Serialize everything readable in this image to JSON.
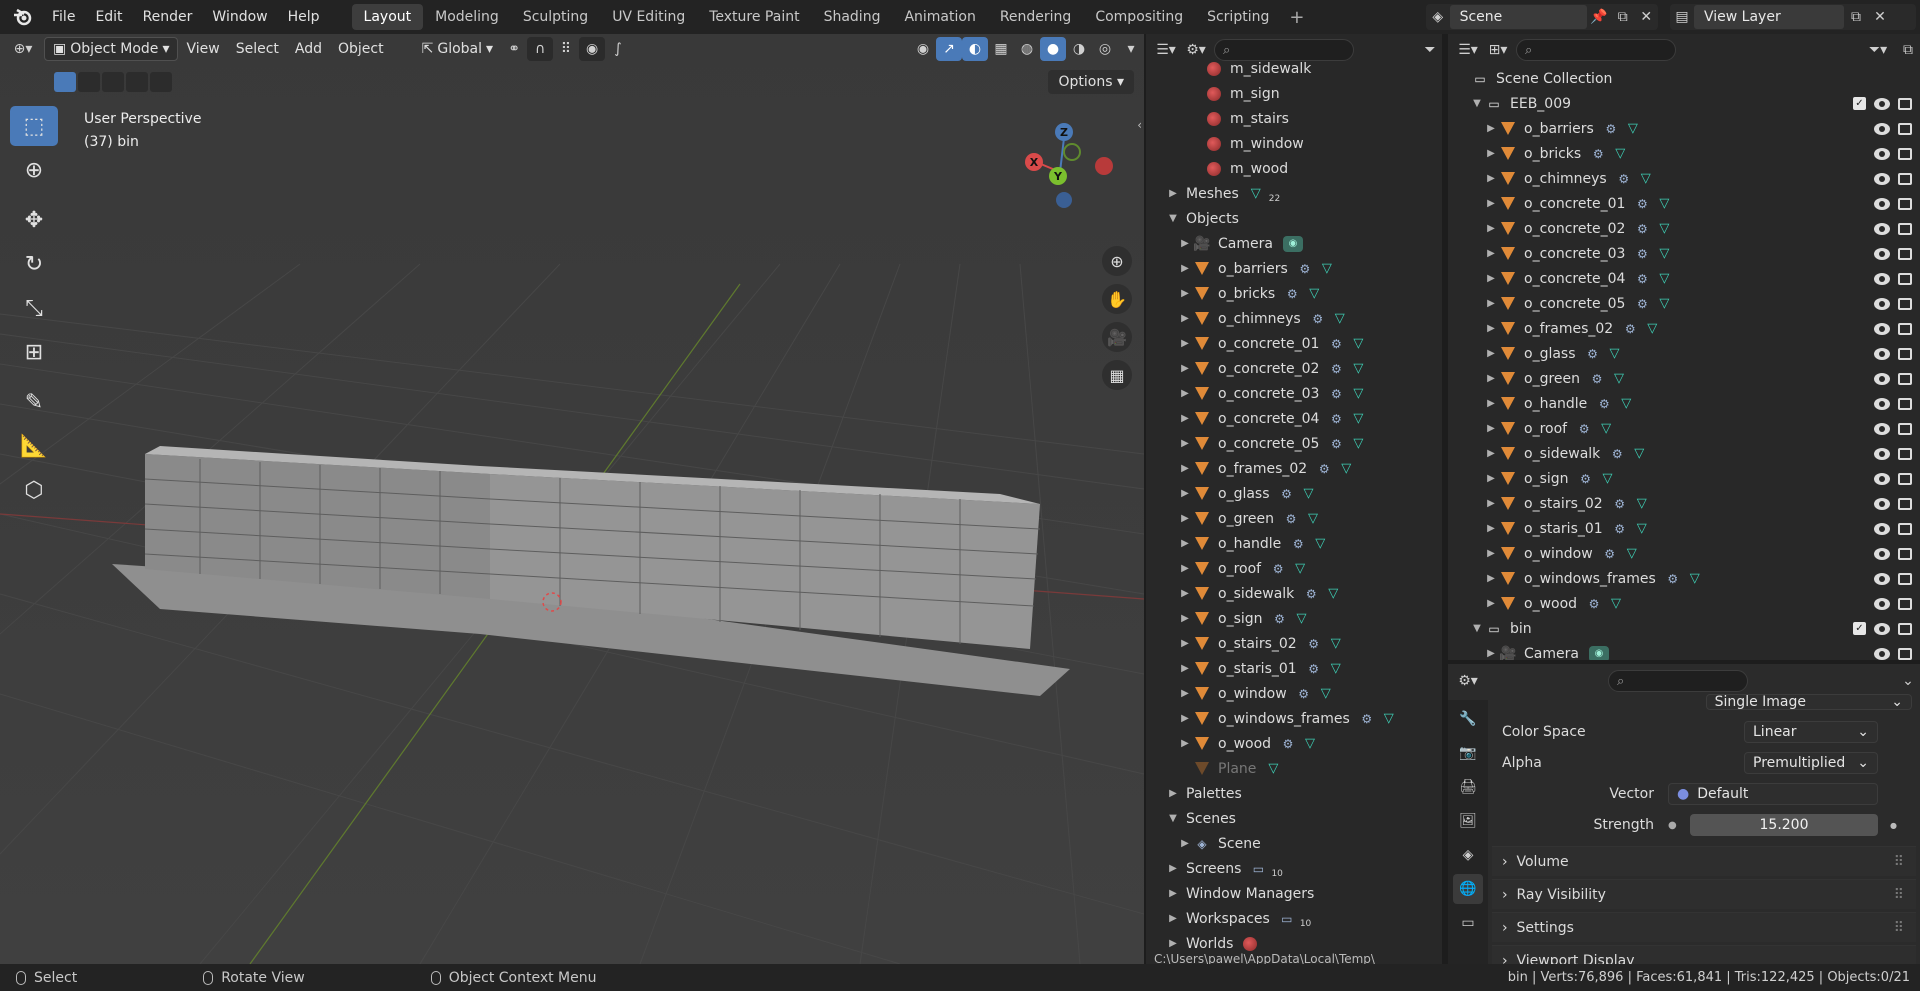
{
  "menu": {
    "items": [
      "File",
      "Edit",
      "Render",
      "Window",
      "Help"
    ]
  },
  "workspaces": {
    "tabs": [
      "Layout",
      "Modeling",
      "Sculpting",
      "UV Editing",
      "Texture Paint",
      "Shading",
      "Animation",
      "Rendering",
      "Compositing",
      "Scripting"
    ],
    "active": "Layout"
  },
  "scene": {
    "name": "Scene",
    "view_layer": "View Layer"
  },
  "viewport": {
    "mode": "Object Mode",
    "menus": [
      "View",
      "Select",
      "Add",
      "Object"
    ],
    "orientation": "Global",
    "info_line1": "User Perspective",
    "info_line2": "(37) bin",
    "options_label": "Options",
    "axes": {
      "x": "X",
      "y": "Y",
      "z": "Z"
    }
  },
  "outliner_file": {
    "rows": [
      {
        "indent": 3,
        "arrow": "",
        "icon": "material",
        "label": "m_sidewalk"
      },
      {
        "indent": 3,
        "arrow": "",
        "icon": "material",
        "label": "m_sign"
      },
      {
        "indent": 3,
        "arrow": "",
        "icon": "material",
        "label": "m_stairs"
      },
      {
        "indent": 3,
        "arrow": "",
        "icon": "material",
        "label": "m_window"
      },
      {
        "indent": 3,
        "arrow": "",
        "icon": "material",
        "label": "m_wood"
      },
      {
        "indent": 1,
        "arrow": "▶",
        "icon": "",
        "label": "Meshes",
        "badge": "mesh",
        "count": "22"
      },
      {
        "indent": 1,
        "arrow": "▼",
        "icon": "",
        "label": "Objects"
      },
      {
        "indent": 2,
        "arrow": "▶",
        "icon": "camera",
        "label": "Camera",
        "badge": "camdata"
      },
      {
        "indent": 2,
        "arrow": "▶",
        "icon": "object",
        "label": "o_barriers",
        "badge": "modmesh"
      },
      {
        "indent": 2,
        "arrow": "▶",
        "icon": "object",
        "label": "o_bricks",
        "badge": "modmesh"
      },
      {
        "indent": 2,
        "arrow": "▶",
        "icon": "object",
        "label": "o_chimneys",
        "badge": "modmesh"
      },
      {
        "indent": 2,
        "arrow": "▶",
        "icon": "object",
        "label": "o_concrete_01",
        "badge": "modmesh"
      },
      {
        "indent": 2,
        "arrow": "▶",
        "icon": "object",
        "label": "o_concrete_02",
        "badge": "modmesh"
      },
      {
        "indent": 2,
        "arrow": "▶",
        "icon": "object",
        "label": "o_concrete_03",
        "badge": "modmesh"
      },
      {
        "indent": 2,
        "arrow": "▶",
        "icon": "object",
        "label": "o_concrete_04",
        "badge": "modmesh"
      },
      {
        "indent": 2,
        "arrow": "▶",
        "icon": "object",
        "label": "o_concrete_05",
        "badge": "modmesh"
      },
      {
        "indent": 2,
        "arrow": "▶",
        "icon": "object",
        "label": "o_frames_02",
        "badge": "modmesh"
      },
      {
        "indent": 2,
        "arrow": "▶",
        "icon": "object",
        "label": "o_glass",
        "badge": "modmesh"
      },
      {
        "indent": 2,
        "arrow": "▶",
        "icon": "object",
        "label": "o_green",
        "badge": "modmesh"
      },
      {
        "indent": 2,
        "arrow": "▶",
        "icon": "object",
        "label": "o_handle",
        "badge": "modmesh"
      },
      {
        "indent": 2,
        "arrow": "▶",
        "icon": "object",
        "label": "o_roof",
        "badge": "modmesh"
      },
      {
        "indent": 2,
        "arrow": "▶",
        "icon": "object",
        "label": "o_sidewalk",
        "badge": "modmesh"
      },
      {
        "indent": 2,
        "arrow": "▶",
        "icon": "object",
        "label": "o_sign",
        "badge": "modmesh"
      },
      {
        "indent": 2,
        "arrow": "▶",
        "icon": "object",
        "label": "o_stairs_02",
        "badge": "modmesh"
      },
      {
        "indent": 2,
        "arrow": "▶",
        "icon": "object",
        "label": "o_staris_01",
        "badge": "modmesh"
      },
      {
        "indent": 2,
        "arrow": "▶",
        "icon": "object",
        "label": "o_window",
        "badge": "modmesh"
      },
      {
        "indent": 2,
        "arrow": "▶",
        "icon": "object",
        "label": "o_windows_frames",
        "badge": "modmesh"
      },
      {
        "indent": 2,
        "arrow": "▶",
        "icon": "object",
        "label": "o_wood",
        "badge": "modmesh"
      },
      {
        "indent": 2,
        "arrow": "",
        "icon": "object-dim",
        "label": "Plane",
        "badge": "mesh",
        "dim": true
      },
      {
        "indent": 1,
        "arrow": "▶",
        "icon": "",
        "label": "Palettes"
      },
      {
        "indent": 1,
        "arrow": "▼",
        "icon": "",
        "label": "Scenes"
      },
      {
        "indent": 2,
        "arrow": "▶",
        "icon": "scene",
        "label": "Scene"
      },
      {
        "indent": 1,
        "arrow": "▶",
        "icon": "",
        "label": "Screens",
        "badge": "screen",
        "count": "10"
      },
      {
        "indent": 1,
        "arrow": "▶",
        "icon": "",
        "label": "Window Managers"
      },
      {
        "indent": 1,
        "arrow": "▶",
        "icon": "",
        "label": "Workspaces",
        "badge": "screen",
        "count": "10"
      },
      {
        "indent": 1,
        "arrow": "▶",
        "icon": "",
        "label": "Worlds",
        "badge": "world"
      }
    ],
    "path": "C:\\Users\\pawel\\AppData\\Local\\Temp\\"
  },
  "outliner_view": {
    "root": "Scene Collection",
    "collection": "EEB_009",
    "objects": [
      "o_barriers",
      "o_bricks",
      "o_chimneys",
      "o_concrete_01",
      "o_concrete_02",
      "o_concrete_03",
      "o_concrete_04",
      "o_concrete_05",
      "o_frames_02",
      "o_glass",
      "o_green",
      "o_handle",
      "o_roof",
      "o_sidewalk",
      "o_sign",
      "o_stairs_02",
      "o_staris_01",
      "o_window",
      "o_windows_frames",
      "o_wood"
    ],
    "collection2": "bin",
    "collection2_items": [
      "Camera"
    ]
  },
  "properties": {
    "partial_top": "Single Image",
    "color_space_label": "Color Space",
    "color_space": "Linear",
    "alpha_label": "Alpha",
    "alpha": "Premultiplied",
    "vector_label": "Vector",
    "vector": "Default",
    "strength_label": "Strength",
    "strength": "15.200",
    "panels": [
      "Volume",
      "Ray Visibility",
      "Settings",
      "Viewport Display"
    ]
  },
  "status": {
    "select": "Select",
    "rotate": "Rotate View",
    "context": "Object Context Menu",
    "stats": "bin | Verts:76,896 | Faces:61,841 | Tris:122,425 | Objects:0/21"
  },
  "colors": {
    "accent": "#4a7ab8",
    "object_orange": "#e08a38",
    "mesh_teal": "#3ecfb5",
    "grid_bg": "#3e3e3e"
  }
}
